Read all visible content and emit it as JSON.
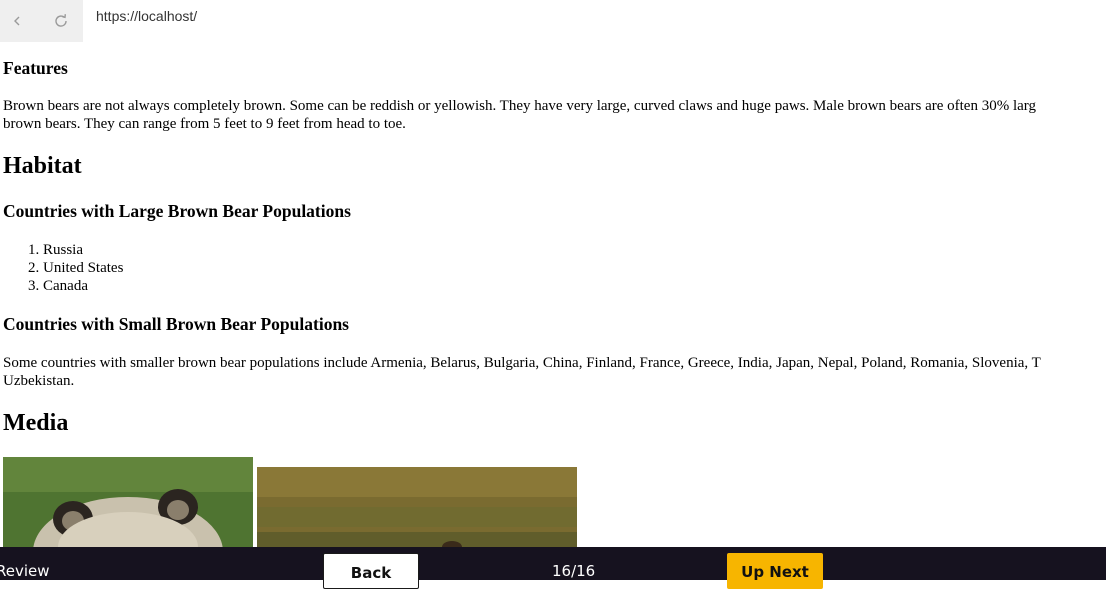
{
  "browser": {
    "url": "https://localhost/",
    "back_icon": "chevron-left-icon",
    "reload_icon": "reload-icon"
  },
  "features": {
    "heading": "Features",
    "line1": "Brown bears are not always completely brown. Some can be reddish or yellowish. They have very large, curved claws and huge paws. Male brown bears are often 30% larg",
    "line2": "brown bears. They can range from 5 feet to 9 feet from head to toe."
  },
  "habitat": {
    "heading": "Habitat",
    "large_heading": "Countries with Large Brown Bear Populations",
    "large_list": [
      "Russia",
      "United States",
      "Canada"
    ],
    "small_heading": "Countries with Small Brown Bear Populations",
    "small_line1": "Some countries with smaller brown bear populations include Armenia, Belarus, Bulgaria, China, Finland, France, Greece, India, Japan, Nepal, Poland, Romania, Slovenia, T",
    "small_line2": "Uzbekistan."
  },
  "media": {
    "heading": "Media"
  },
  "bottom_bar": {
    "review_label": "Review",
    "back_label": "Back",
    "page_counter": "16/16",
    "next_label": "Up Next",
    "accent_color": "#f7b500",
    "bar_color": "#16121f"
  }
}
